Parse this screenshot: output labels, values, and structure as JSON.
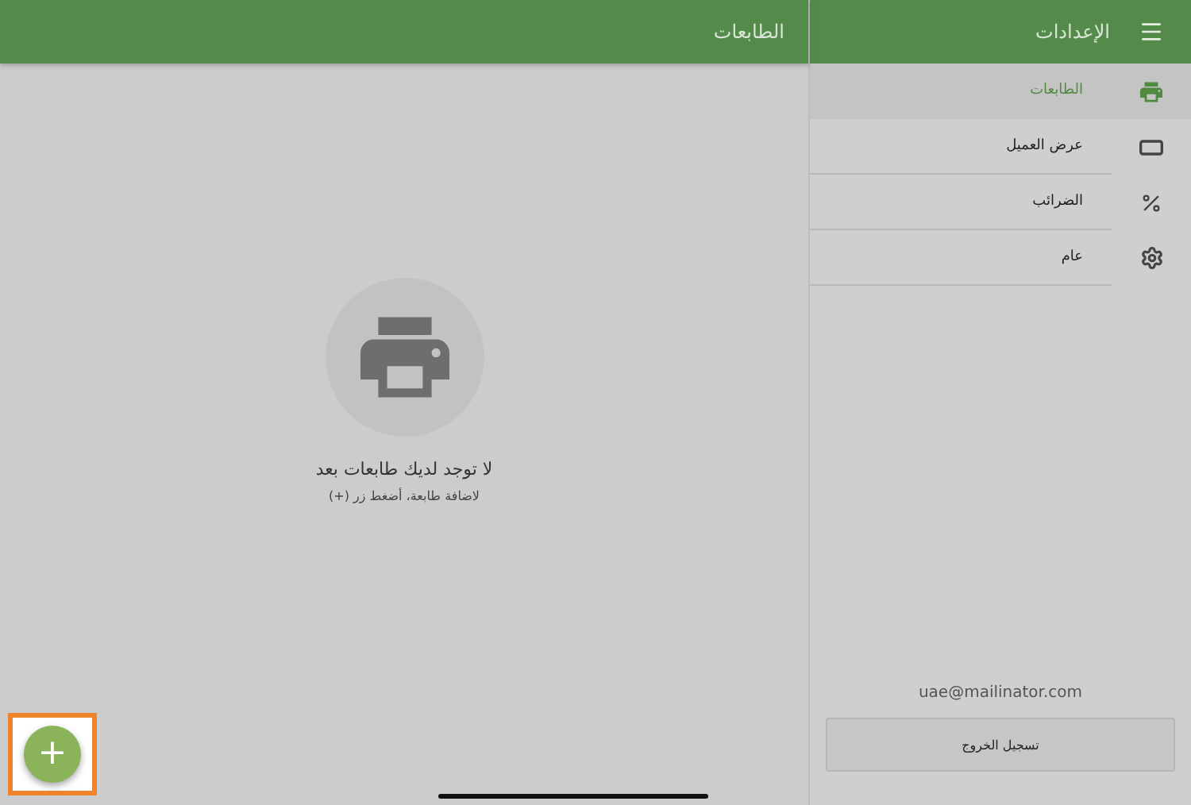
{
  "header": {
    "title": "الطابعات",
    "settings_title": "الإعدادات"
  },
  "sidebar": {
    "items": [
      {
        "label": "الطابعات",
        "selected": true
      },
      {
        "label": "عرض العميل",
        "selected": false
      },
      {
        "label": "الضرائب",
        "selected": false
      },
      {
        "label": "عام",
        "selected": false
      }
    ],
    "email": "uae@mailinator.com",
    "logout": "تسجيل الخروج"
  },
  "empty_state": {
    "title": "لا توجد لديك طابعات بعد",
    "hint": "لاضافة طابعة، أضغط زر (+)"
  },
  "fab": {
    "label": "+"
  }
}
